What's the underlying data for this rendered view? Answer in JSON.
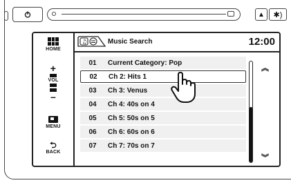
{
  "topbar": {
    "power_icon": "power-icon",
    "eject_label": "▲",
    "bt_label": "✱)"
  },
  "rail": {
    "home_label": "HOME",
    "vol_label": "VOL",
    "vol_plus": "+",
    "vol_minus": "–",
    "menu_label": "MENU",
    "back_label": "BACK",
    "back_glyph": "⮌"
  },
  "header": {
    "title": "Music Search",
    "clock": "12:00"
  },
  "list": {
    "rows": [
      {
        "num": "01",
        "name": "Current Category: Pop"
      },
      {
        "num": "02",
        "name": "Ch 2: Hits 1"
      },
      {
        "num": "03",
        "name": "Ch 3: Venus"
      },
      {
        "num": "04",
        "name": "Ch 4: 40s on 4"
      },
      {
        "num": "05",
        "name": "Ch 5: 50s on 5"
      },
      {
        "num": "06",
        "name": "Ch 6: 60s on 6"
      },
      {
        "num": "07",
        "name": "Ch 7: 70s on 7"
      }
    ],
    "selected_index": 1
  },
  "scroll": {
    "up_glyph": "︽",
    "down_glyph": "︾",
    "thumb_fraction": 0.55
  }
}
